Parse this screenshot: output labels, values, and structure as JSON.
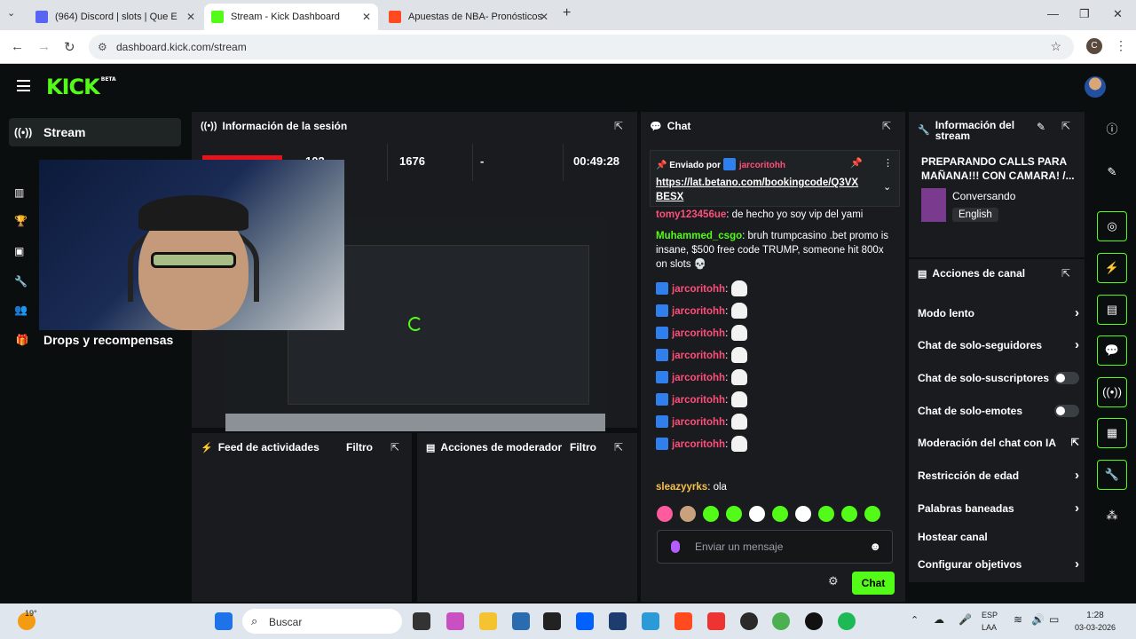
{
  "browser": {
    "tabs": [
      {
        "label": "(964) Discord | slots | Que E",
        "fav_color": "#5865f2"
      },
      {
        "label": "Stream - Kick Dashboard",
        "fav_color": "#53fc18"
      },
      {
        "label": "Apuestas de NBA- Pronósticos",
        "fav_color": "#ff4b1f"
      }
    ],
    "url": "dashboard.kick.com/stream",
    "profile_initial": "C"
  },
  "kick": {
    "logo": "KICK",
    "beta": "BETA"
  },
  "sidebar": {
    "items": [
      {
        "label": "Stream",
        "icon": "broadcast-icon"
      },
      {
        "label": "Drops y recompensas",
        "icon": "drops-icon"
      }
    ]
  },
  "session": {
    "title": "Información de la sesión",
    "viewers": "102",
    "followers": "1676",
    "subs": "-",
    "uptime": "00:49:28"
  },
  "activity": {
    "title": "Feed de actividades",
    "filter": "Filtro"
  },
  "moderator": {
    "title": "Acciones de moderador",
    "filter": "Filtro"
  },
  "chat": {
    "title": "Chat",
    "pinned_label": "Enviado por",
    "pinned_user": "jarcoritohh",
    "pinned_link": "https://lat.betano.com/bookingcode/Q3VX BESX",
    "messages": [
      {
        "user": "tomy123456ue",
        "text": "de hecho yo soy vip del yami",
        "color": "pink"
      },
      {
        "user": "Muhammed_csgo",
        "text": "bruh trumpcasino .bet promo is insane, $500 free code TRUMP, someone hit 800x on slots 💀",
        "color": "green"
      },
      {
        "user": "jarcoritohh",
        "text": ":",
        "color": "pink"
      },
      {
        "user": "jarcoritohh",
        "text": ":",
        "color": "pink"
      },
      {
        "user": "jarcoritohh",
        "text": ":",
        "color": "pink"
      },
      {
        "user": "jarcoritohh",
        "text": ":",
        "color": "pink"
      },
      {
        "user": "jarcoritohh",
        "text": ":",
        "color": "pink"
      },
      {
        "user": "jarcoritohh",
        "text": ":",
        "color": "pink"
      },
      {
        "user": "jarcoritohh",
        "text": ":",
        "color": "pink"
      },
      {
        "user": "jarcoritohh",
        "text": ":",
        "color": "pink"
      },
      {
        "user": "sleazyyrks",
        "text": "ola",
        "color": "yellow"
      }
    ],
    "placeholder": "Enviar un mensaje",
    "send": "Chat"
  },
  "stream_info": {
    "title": "Información del stream",
    "stream_title": "PREPARANDO CALLS PARA MAÑANA!!! CON CAMARA! /...",
    "category": "Conversando",
    "language": "English"
  },
  "channel_actions": {
    "title": "Acciones de canal",
    "items": [
      {
        "label": "Modo lento",
        "control": "chevron"
      },
      {
        "label": "Chat de solo-seguidores",
        "control": "chevron"
      },
      {
        "label": "Chat de solo-suscriptores",
        "control": "toggle"
      },
      {
        "label": "Chat de solo-emotes",
        "control": "toggle"
      },
      {
        "label": "Moderación del chat con IA",
        "control": "external"
      },
      {
        "label": "Restricción de edad",
        "control": "chevron"
      },
      {
        "label": "Palabras baneadas",
        "control": "chevron"
      },
      {
        "label": "Hostear canal",
        "control": "none"
      },
      {
        "label": "Configurar objetivos",
        "control": "chevron"
      }
    ]
  },
  "taskbar": {
    "weather": "19°",
    "search": "Buscar",
    "lang1": "ESP",
    "lang2": "LAA",
    "time": "1:28",
    "date": "03-03-2026"
  }
}
